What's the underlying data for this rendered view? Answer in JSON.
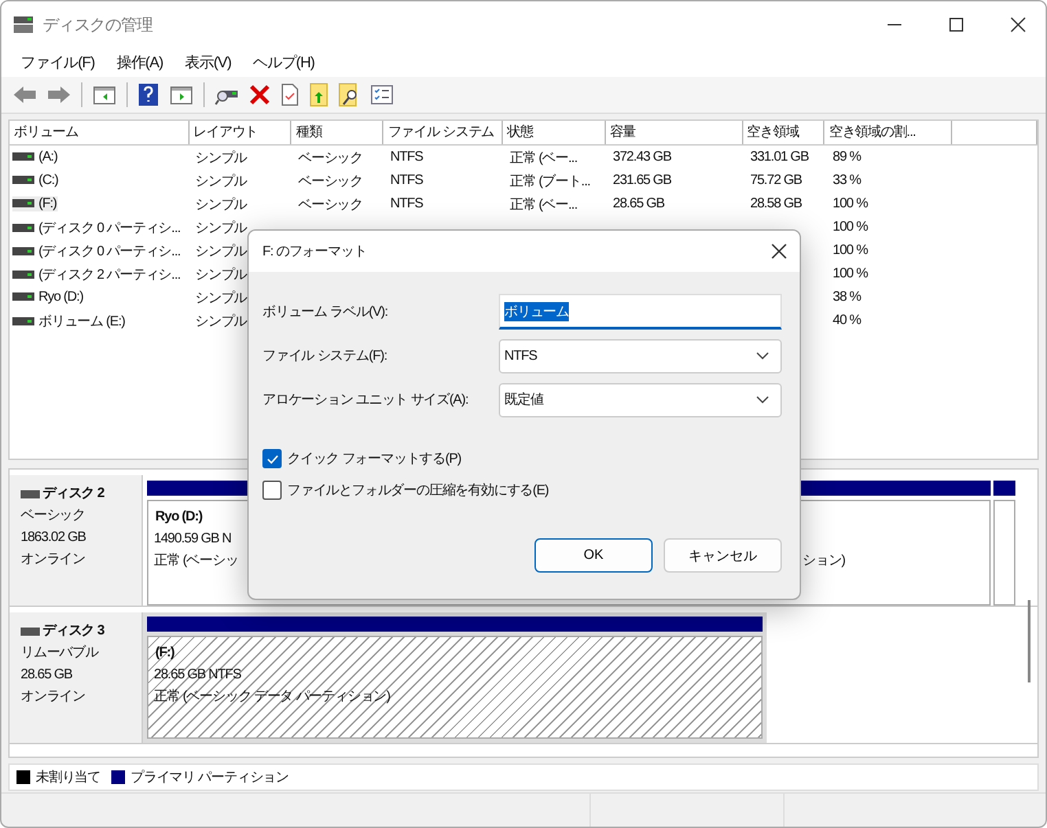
{
  "window": {
    "title": "ディスクの管理"
  },
  "menu": [
    {
      "label": "ファイル(F)"
    },
    {
      "label": "操作(A)"
    },
    {
      "label": "表示(V)"
    },
    {
      "label": "ヘルプ(H)"
    }
  ],
  "volume_table": {
    "columns": [
      "ボリューム",
      "レイアウト",
      "種類",
      "ファイル システム",
      "状態",
      "容量",
      "空き領域",
      "空き領域の割..."
    ],
    "rows": [
      {
        "selected": false,
        "volume": "(A:)",
        "layout": "シンプル",
        "type": "ベーシック",
        "file_system": "NTFS",
        "status": "正常 (ベー...",
        "capacity": "372.43 GB",
        "free_space": "331.01 GB",
        "percent_free": "89 %"
      },
      {
        "selected": false,
        "volume": "(C:)",
        "layout": "シンプル",
        "type": "ベーシック",
        "file_system": "NTFS",
        "status": "正常 (ブート...",
        "capacity": "231.65 GB",
        "free_space": "75.72 GB",
        "percent_free": "33 %"
      },
      {
        "selected": true,
        "volume": "(F:)",
        "layout": "シンプル",
        "type": "ベーシック",
        "file_system": "NTFS",
        "status": "正常 (ベー...",
        "capacity": "28.65 GB",
        "free_space": "28.58 GB",
        "percent_free": "100 %"
      },
      {
        "selected": false,
        "volume": "(ディスク 0 パーティシ...",
        "layout": "シンプル",
        "percent_free": "100 %"
      },
      {
        "selected": false,
        "volume": "(ディスク 0 パーティシ...",
        "layout": "シンプル",
        "percent_free": "100 %"
      },
      {
        "selected": false,
        "volume": "(ディスク 2 パーティシ...",
        "layout": "シンプル",
        "percent_free": "100 %"
      },
      {
        "selected": false,
        "volume": "Ryo (D:)",
        "layout": "シンプル",
        "percent_free": "38 %"
      },
      {
        "selected": false,
        "volume": "ボリューム (E:)",
        "layout": "シンプル",
        "percent_free": "40 %"
      }
    ]
  },
  "disks": [
    {
      "name": "ディスク 2",
      "type": "ベーシック",
      "size": "1863.02 GB",
      "status": "オンライン",
      "partitions": [
        {
          "selected": false,
          "name": "Ryo  (D:)",
          "lines": [
            "1490.59 GB N",
            "正常 (ベーシッ"
          ],
          "tail": "ション)"
        },
        {
          "selected": false
        }
      ]
    },
    {
      "name": "ディスク 3",
      "type": "リムーバブル",
      "size": "28.65 GB",
      "status": "オンライン",
      "partitions": [
        {
          "selected": true,
          "name": "(F:)",
          "lines": [
            "28.65 GB NTFS",
            "正常 (ベーシック データ パーティション)"
          ]
        }
      ]
    }
  ],
  "legend": [
    {
      "label": "未割り当て",
      "color": "#000000"
    },
    {
      "label": "プライマリ パーティション",
      "color": "#000080"
    }
  ],
  "dialog": {
    "title": "F: のフォーマット",
    "fields": [
      {
        "kind": "text",
        "label": "ボリューム ラベル(V):",
        "value": "ボリューム",
        "selected": true
      },
      {
        "kind": "dropdown",
        "label": "ファイル システム(F):",
        "value": "NTFS"
      },
      {
        "kind": "dropdown",
        "label": "アロケーション ユニット サイズ(A):",
        "value": "既定値"
      }
    ],
    "checkboxes": [
      {
        "label": "クイック フォーマットする(P)",
        "checked": true
      },
      {
        "label": "ファイルとフォルダーの圧縮を有効にする(E)",
        "checked": false
      }
    ],
    "buttons": [
      {
        "label": "OK",
        "default": true
      },
      {
        "label": "キャンセル",
        "default": false
      }
    ]
  }
}
